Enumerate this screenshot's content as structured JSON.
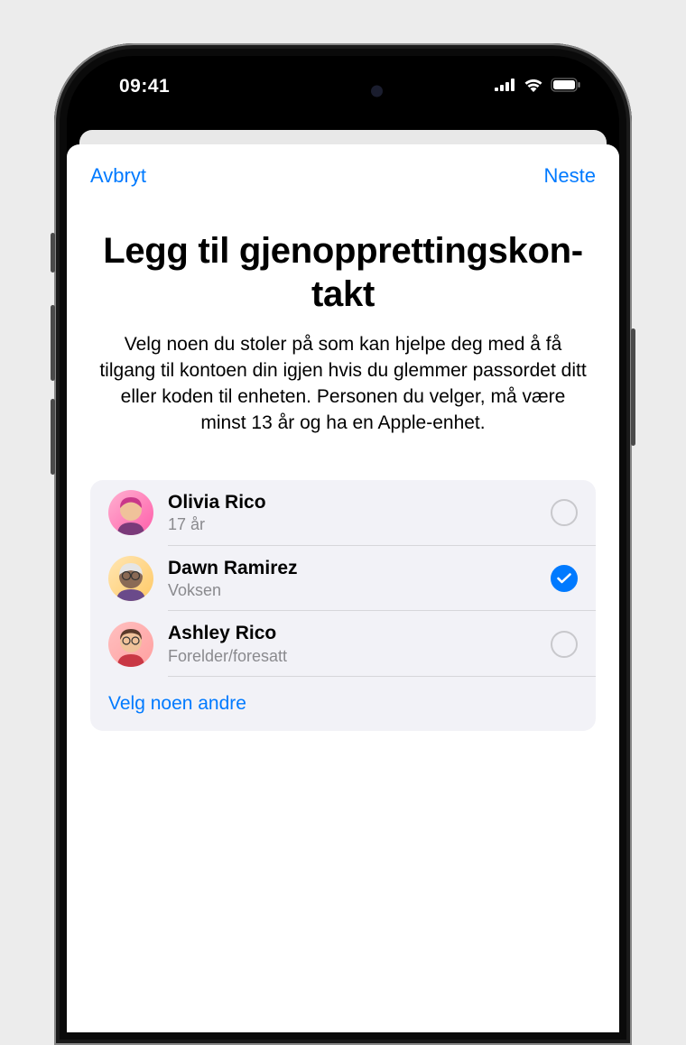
{
  "status": {
    "time": "09:41"
  },
  "nav": {
    "cancel": "Avbryt",
    "next": "Neste"
  },
  "page": {
    "title": "Legg til gjenopprettingskon-takt",
    "description": "Velg noen du stoler på som kan hjelpe deg med å få tilgang til kontoen din igjen hvis du glemmer passordet ditt eller koden til enheten. Personen du velger, må være minst 13 år og ha en Apple-enhet."
  },
  "contacts": [
    {
      "name": "Olivia Rico",
      "meta": "17 år",
      "selected": false
    },
    {
      "name": "Dawn Ramirez",
      "meta": "Voksen",
      "selected": true
    },
    {
      "name": "Ashley Rico",
      "meta": "Forelder/foresatt",
      "selected": false
    }
  ],
  "chooseOther": "Velg noen andre"
}
